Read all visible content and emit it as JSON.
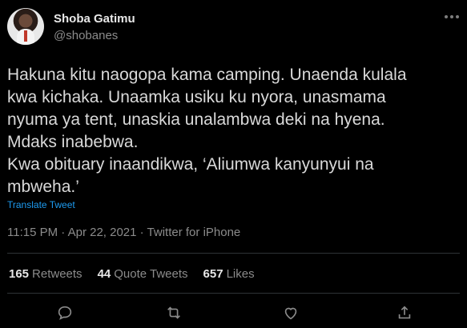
{
  "author": {
    "name": "Shoba Gatimu",
    "handle": "@shobanes"
  },
  "tweet": {
    "lines": [
      "Hakuna kitu naogopa kama camping. Unaenda kulala",
      "kwa kichaka. Unaamka usiku ku nyora, unasmama",
      "nyuma ya tent, unaskia unalambwa deki na hyena.",
      "Mdaks inabebwa.",
      "Kwa obituary inaandikwa, ‘Aliumwa kanyunyui na",
      "mbweha.’"
    ],
    "translate_label": "Translate Tweet",
    "timestamp": "11:15 PM · Apr 22, 2021 · Twitter for iPhone"
  },
  "stats": {
    "retweets_count": "165",
    "retweets_label": "Retweets",
    "quotes_count": "44",
    "quotes_label": "Quote Tweets",
    "likes_count": "657",
    "likes_label": "Likes"
  },
  "icons": {
    "more": "more-icon",
    "reply": "reply-icon",
    "retweet": "retweet-icon",
    "like": "heart-icon",
    "share": "share-icon"
  },
  "colors": {
    "background": "#000000",
    "link": "#1d9bf0",
    "muted": "#8b8b8b",
    "divider": "#2f3336"
  }
}
